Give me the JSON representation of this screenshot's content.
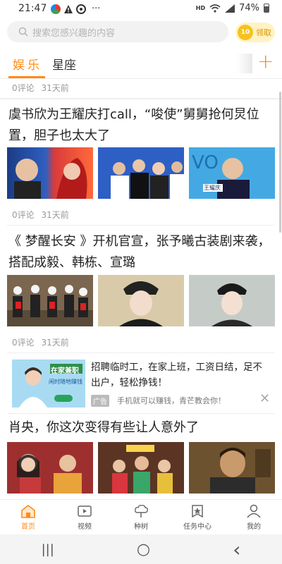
{
  "status_bar": {
    "time": "21:47",
    "battery": "74%",
    "network": "HD"
  },
  "search": {
    "placeholder": "搜索您感兴趣的内容",
    "coin_text": "10",
    "claim_label": "领取"
  },
  "tabs": [
    {
      "label": "娱乐",
      "active": true
    },
    {
      "label": "星座",
      "active": false
    }
  ],
  "add_tab_label": "+",
  "feed": {
    "top_meta": {
      "comments": "0评论",
      "time": "31天前"
    },
    "articles": [
      {
        "title": "虞书欣为王耀庆打call，“唆使”舅舅抢何炅位置，胆子也太大了",
        "comments": "0评论",
        "time": "31天前",
        "thumb_caption": "王耀庆"
      },
      {
        "title": "《 梦醒长安 》开机官宣，张予曦古装剧来袭，搭配成毅、韩栋、宣璐",
        "comments": "0评论",
        "time": "31天前"
      },
      {
        "title": "肖央，你这次变得有些让人意外了"
      }
    ],
    "ad": {
      "title": "招聘临时工，在家上班，工资日结，足不出户，轻松挣钱！",
      "badge": "广告",
      "desc": "手机就可以赚钱，青芒教会你！",
      "image_title": "在家兼职",
      "image_sub": "闲时随地赚钱",
      "close": "✕"
    }
  },
  "bottom_nav": [
    {
      "label": "首页",
      "icon": "home-icon",
      "active": true
    },
    {
      "label": "视频",
      "icon": "video-icon",
      "active": false
    },
    {
      "label": "种树",
      "icon": "tree-icon",
      "active": false
    },
    {
      "label": "任务中心",
      "icon": "task-icon",
      "active": false
    },
    {
      "label": "我的",
      "icon": "profile-icon",
      "active": false
    }
  ],
  "system_nav": {
    "recents": "|||",
    "home": "○",
    "back": "‹"
  },
  "colors": {
    "accent": "#ff8a16",
    "meta_text": "#999999",
    "coin": "#f6c21f"
  }
}
